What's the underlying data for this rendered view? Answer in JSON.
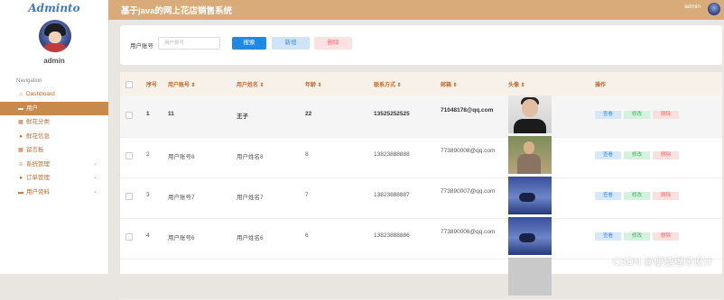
{
  "sidebar": {
    "logo": "Adminto",
    "admin_name": "admin",
    "nav_title": "Navigation",
    "items": [
      {
        "label": "Dashboard",
        "icon": "home-icon",
        "active": false,
        "expandable": false
      },
      {
        "label": "用户",
        "icon": "card-icon",
        "active": true,
        "expandable": false
      },
      {
        "label": "鲜花分类",
        "icon": "grid-icon",
        "active": false,
        "expandable": false
      },
      {
        "label": "鲜花信息",
        "icon": "person-icon",
        "active": false,
        "expandable": false
      },
      {
        "label": "留言板",
        "icon": "grid-icon",
        "active": false,
        "expandable": false
      },
      {
        "label": "系统管理",
        "icon": "list-icon",
        "active": false,
        "expandable": true
      },
      {
        "label": "订单管理",
        "icon": "person-icon",
        "active": false,
        "expandable": true
      },
      {
        "label": "用户资料",
        "icon": "card-icon",
        "active": false,
        "expandable": true
      }
    ]
  },
  "header": {
    "title": "基于java的网上花店销售系统",
    "user": "admin"
  },
  "search": {
    "label": "用户账号",
    "placeholder": "用户账号",
    "search_button": "搜索",
    "add_button": "新增",
    "delete_button": "删除"
  },
  "table": {
    "columns": [
      "序号",
      "用户账号 ⇕",
      "用户姓名 ⇕",
      "年龄 ⇕",
      "联系方式 ⇕",
      "邮箱 ⇕",
      "头像 ⇕",
      "操作"
    ],
    "rows": [
      {
        "index": "1",
        "account": "11",
        "name": "王子",
        "age": "22",
        "phone": "13525252525",
        "email": "71048178@qq.com",
        "photo": "man1",
        "highlight": true
      },
      {
        "index": "2",
        "account": "用户账号8",
        "name": "用户姓名8",
        "age": "8",
        "phone": "13823888888",
        "email": "773890008@qq.com",
        "photo": "man2",
        "highlight": false
      },
      {
        "index": "3",
        "account": "用户账号7",
        "name": "用户姓名7",
        "age": "7",
        "phone": "13823888887",
        "email": "773890007@qq.com",
        "photo": "sky",
        "highlight": false
      },
      {
        "index": "4",
        "account": "用户账号6",
        "name": "用户姓名6",
        "age": "6",
        "phone": "13823888886",
        "email": "773890006@qq.com",
        "photo": "sky",
        "highlight": false
      },
      {
        "index": "",
        "account": "",
        "name": "",
        "age": "",
        "phone": "",
        "email": "",
        "photo": "grey",
        "highlight": false
      }
    ],
    "actions": {
      "view": "查看",
      "edit": "修改",
      "delete": "删除"
    }
  },
  "watermark": "CSDN @便捷程序设计",
  "colors": {
    "header_bg": "#d9ab79",
    "active_nav": "#c88a4c",
    "accent_text": "#c26a2b",
    "primary_button": "#1e88e5"
  }
}
